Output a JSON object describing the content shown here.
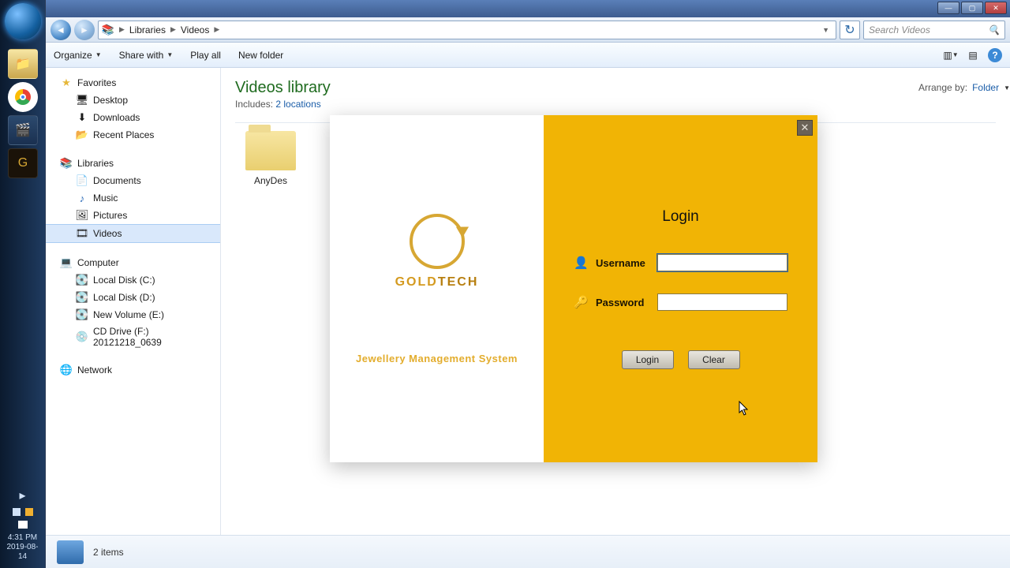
{
  "window": {
    "breadcrumb_root": "Libraries",
    "breadcrumb_sub": "Videos"
  },
  "search": {
    "placeholder": "Search Videos"
  },
  "toolbar": {
    "organize": "Organize",
    "share": "Share with",
    "play": "Play all",
    "newfolder": "New folder"
  },
  "nav": {
    "favorites": {
      "head": "Favorites",
      "desktop": "Desktop",
      "downloads": "Downloads",
      "recent": "Recent Places"
    },
    "libraries": {
      "head": "Libraries",
      "documents": "Documents",
      "music": "Music",
      "pictures": "Pictures",
      "videos": "Videos"
    },
    "computer": {
      "head": "Computer",
      "c": "Local Disk (C:)",
      "d": "Local Disk (D:)",
      "e": "New Volume (E:)",
      "f": "CD Drive (F:) 20121218_0639"
    },
    "network": {
      "head": "Network"
    }
  },
  "library": {
    "title": "Videos library",
    "includes_label": "Includes:",
    "includes_link": "2 locations",
    "arrange_label": "Arrange by:",
    "arrange_value": "Folder"
  },
  "items": {
    "folder1": "AnyDes"
  },
  "status": {
    "count": "2 items"
  },
  "tray": {
    "time": "4:31 PM",
    "date": "2019-08-14"
  },
  "login": {
    "brand": "GOLD",
    "brand2": "TECH",
    "tagline": "Jewellery Management System",
    "title": "Login",
    "username_label": "Username",
    "password_label": "Password",
    "login_btn": "Login",
    "clear_btn": "Clear",
    "username_value": "",
    "password_value": ""
  }
}
